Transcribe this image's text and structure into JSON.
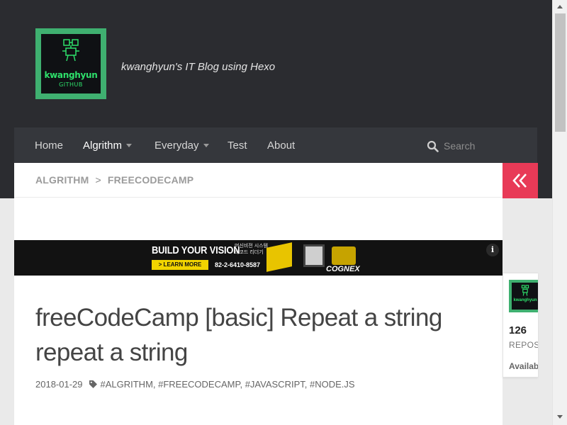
{
  "site": {
    "logo_name": "kwanghyun",
    "logo_sub": "GITHUB",
    "tagline": "kwanghyun's IT Blog using Hexo"
  },
  "nav": {
    "items": [
      {
        "label": "Home",
        "dropdown": false,
        "active": false
      },
      {
        "label": "Algrithm",
        "dropdown": true,
        "active": true
      },
      {
        "label": "Everyday",
        "dropdown": true,
        "active": false
      },
      {
        "label": "Test",
        "dropdown": false,
        "active": false
      },
      {
        "label": "About",
        "dropdown": false,
        "active": false
      }
    ],
    "search_placeholder": "Search",
    "search_icon": "search-icon"
  },
  "breadcrumb": {
    "items": [
      "ALGRITHM",
      "FREECODECAMP"
    ],
    "separator": ">"
  },
  "ad": {
    "headline": "BUILD YOUR VISION",
    "korean_line1": "머신비전 시스템",
    "korean_line2": "바코드 리더기",
    "cta": "> LEARN MORE",
    "phone": "82-2-6410-8587",
    "brand": "COGNEX",
    "info_icon": "i"
  },
  "post": {
    "title": "freeCodeCamp [basic] Repeat a string repeat a string",
    "date": "2018-01-29",
    "tags": "#ALGRITHM, #FREECODECAMP, #JAVASCRIPT, #NODE.JS"
  },
  "sidebar": {
    "toggle_icon": "double-chevron-left-icon",
    "logo_name": "kwanghyun",
    "repo_count": "126",
    "repos_label": "REPOS",
    "available_label": "Availab"
  },
  "colors": {
    "header_bg": "#2b2c30",
    "nav_bg": "#35373c",
    "accent": "#e83a57",
    "logo_green": "#3fb070"
  }
}
